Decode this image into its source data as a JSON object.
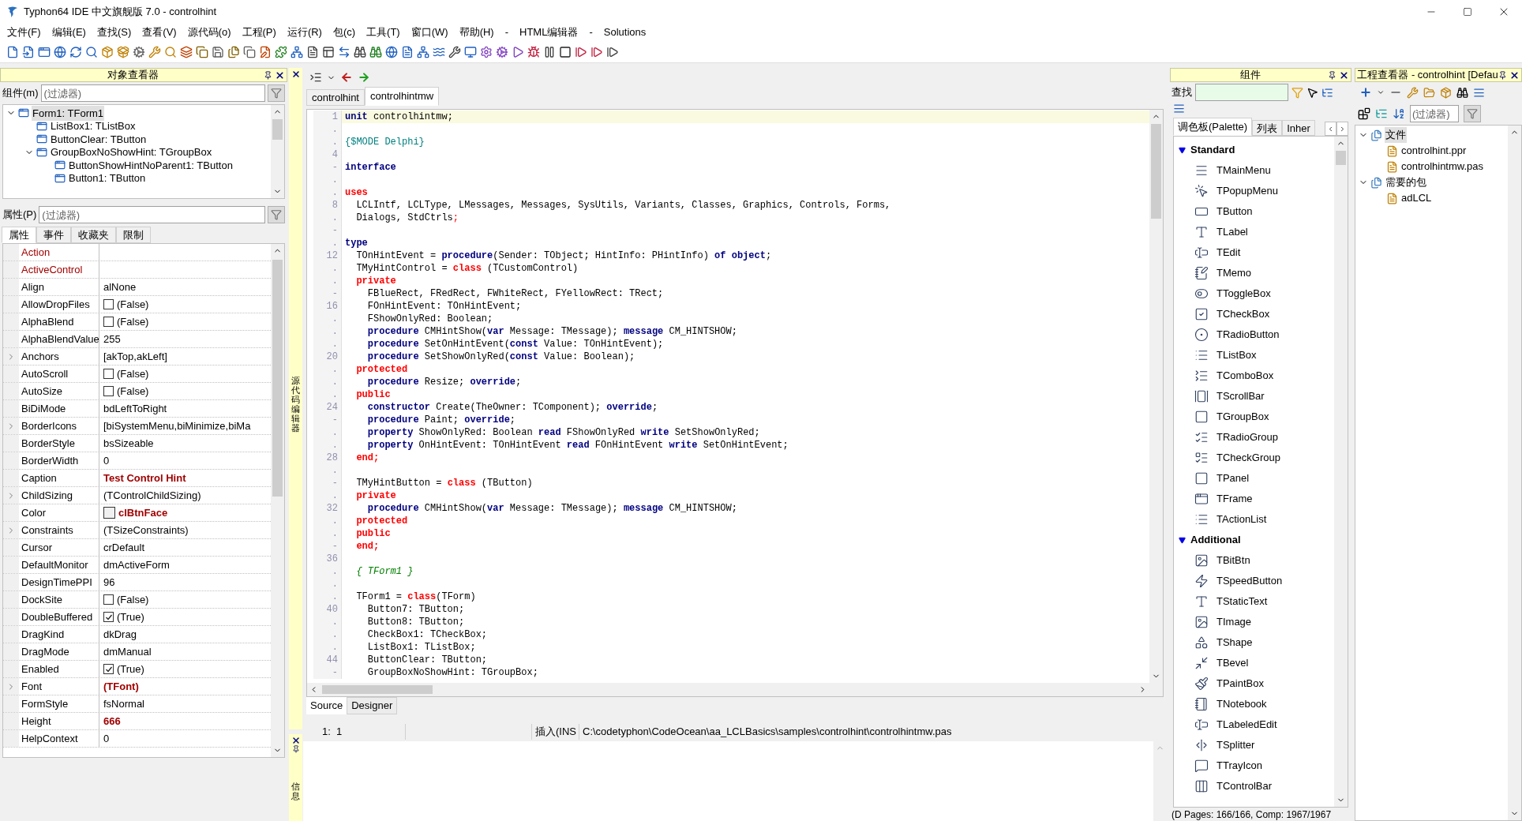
{
  "window": {
    "title": "Typhon64 IDE 中文旗舰版 7.0 - controlhint"
  },
  "menu": [
    "文件(F)",
    "编辑(E)",
    "查找(S)",
    "查看(V)",
    "源代码(o)",
    "工程(P)",
    "运行(R)",
    "包(c)",
    "工具(T)",
    "窗口(W)",
    "帮助(H)",
    "-",
    "HTML编辑器",
    "-",
    "Solutions"
  ],
  "object_inspector": {
    "title": "对象查看器",
    "component_filter": {
      "label": "组件(m)",
      "placeholder": "(过滤器)"
    },
    "tree": [
      {
        "label": "Form1: TForm1",
        "selected": true,
        "expanded": true,
        "children": [
          {
            "label": "ListBox1: TListBox",
            "selected": false
          },
          {
            "label": "ButtonClear: TButton",
            "selected": false
          },
          {
            "label": "GroupBoxNoShowHint: TGroupBox",
            "selected": false,
            "expanded": true,
            "children": [
              {
                "label": "ButtonShowHintNoParent1: TButton",
                "selected": false
              },
              {
                "label": "Button1: TButton",
                "selected": false
              }
            ]
          }
        ]
      }
    ],
    "property_filter": {
      "label": "属性(P)",
      "placeholder": "(过滤器)"
    },
    "tabs": [
      {
        "label": "属性",
        "selected": true
      },
      {
        "label": "事件",
        "selected": false
      },
      {
        "label": "收藏夹",
        "selected": false
      },
      {
        "label": "限制",
        "selected": false
      }
    ],
    "properties": [
      {
        "name": "Action",
        "kind": "text",
        "link": true,
        "expandable": false
      },
      {
        "name": "ActiveControl",
        "kind": "text",
        "link": true,
        "expandable": false
      },
      {
        "name": "Align",
        "value": "alNone",
        "kind": "text",
        "link": false,
        "expandable": false,
        "modified": false
      },
      {
        "name": "AllowDropFiles",
        "value": "(False)",
        "kind": "bool",
        "checked": false,
        "link": false,
        "expandable": false,
        "modified": false
      },
      {
        "name": "AlphaBlend",
        "value": "(False)",
        "kind": "bool",
        "checked": false,
        "link": false,
        "expandable": false,
        "modified": false
      },
      {
        "name": "AlphaBlendValue",
        "value": "255",
        "kind": "text",
        "link": false,
        "expandable": false,
        "modified": false
      },
      {
        "name": "Anchors",
        "value": "[akTop,akLeft]",
        "kind": "text",
        "link": false,
        "expandable": true,
        "modified": false
      },
      {
        "name": "AutoScroll",
        "value": "(False)",
        "kind": "bool",
        "checked": false,
        "link": false,
        "expandable": false,
        "modified": false
      },
      {
        "name": "AutoSize",
        "value": "(False)",
        "kind": "bool",
        "checked": false,
        "link": false,
        "expandable": false,
        "modified": false
      },
      {
        "name": "BiDiMode",
        "value": "bdLeftToRight",
        "kind": "text",
        "link": false,
        "expandable": false,
        "modified": false
      },
      {
        "name": "BorderIcons",
        "value": "[biSystemMenu,biMinimize,biMa",
        "kind": "text",
        "link": false,
        "expandable": true,
        "modified": false
      },
      {
        "name": "BorderStyle",
        "value": "bsSizeable",
        "kind": "text",
        "link": false,
        "expandable": false,
        "modified": false
      },
      {
        "name": "BorderWidth",
        "value": "0",
        "kind": "text",
        "link": false,
        "expandable": false,
        "modified": false
      },
      {
        "name": "Caption",
        "value": "Test Control Hint",
        "kind": "text",
        "link": false,
        "expandable": false,
        "modified": true
      },
      {
        "name": "ChildSizing",
        "value": "(TControlChildSizing)",
        "kind": "text",
        "link": false,
        "expandable": true,
        "modified": false
      },
      {
        "name": "Color",
        "value": "clBtnFace",
        "kind": "color",
        "color": "#f0f0f0",
        "link": false,
        "expandable": false,
        "modified": true
      },
      {
        "name": "Constraints",
        "value": "(TSizeConstraints)",
        "kind": "text",
        "link": false,
        "expandable": true,
        "modified": false
      },
      {
        "name": "Cursor",
        "value": "crDefault",
        "kind": "text",
        "link": false,
        "expandable": false,
        "modified": false
      },
      {
        "name": "DefaultMonitor",
        "value": "dmActiveForm",
        "kind": "text",
        "link": false,
        "expandable": false,
        "modified": false
      },
      {
        "name": "DesignTimePPI",
        "value": "96",
        "kind": "text",
        "link": false,
        "expandable": false,
        "modified": false
      },
      {
        "name": "DockSite",
        "value": "(False)",
        "kind": "bool",
        "checked": false,
        "link": false,
        "expandable": false,
        "modified": false
      },
      {
        "name": "DoubleBuffered",
        "value": "(True)",
        "kind": "bool",
        "checked": true,
        "link": false,
        "expandable": false,
        "modified": false
      },
      {
        "name": "DragKind",
        "value": "dkDrag",
        "kind": "text",
        "link": false,
        "expandable": false,
        "modified": false
      },
      {
        "name": "DragMode",
        "value": "dmManual",
        "kind": "text",
        "link": false,
        "expandable": false,
        "modified": false
      },
      {
        "name": "Enabled",
        "value": "(True)",
        "kind": "bool",
        "checked": true,
        "link": false,
        "expandable": false,
        "modified": false
      },
      {
        "name": "Font",
        "value": "(TFont)",
        "kind": "text",
        "link": false,
        "expandable": true,
        "modified": true
      },
      {
        "name": "FormStyle",
        "value": "fsNormal",
        "kind": "text",
        "link": false,
        "expandable": false,
        "modified": false
      },
      {
        "name": "Height",
        "value": "666",
        "kind": "text",
        "link": false,
        "expandable": false,
        "modified": true
      },
      {
        "name": "HelpContext",
        "value": "0",
        "kind": "text",
        "link": false,
        "expandable": false,
        "modified": false
      }
    ]
  },
  "editor": {
    "side_label": "源代码编辑器",
    "tabs": [
      {
        "label": "controlhint",
        "selected": false
      },
      {
        "label": "controlhintmw",
        "selected": true
      }
    ],
    "lines": [
      {
        "gutter": "1",
        "current": true,
        "tokens": [
          {
            "kind": "keyword",
            "text": "unit"
          },
          {
            "kind": "plain",
            "text": " controlhintmw;"
          }
        ]
      },
      {
        "gutter": ".",
        "current": false
      },
      {
        "gutter": ".",
        "current": false,
        "tokens": [
          {
            "kind": "directive",
            "text": "{$MODE Delphi}"
          }
        ]
      },
      {
        "gutter": "4",
        "current": false
      },
      {
        "gutter": "-",
        "current": false,
        "tokens": [
          {
            "kind": "keyword",
            "text": "interface"
          }
        ]
      },
      {
        "gutter": ".",
        "current": false
      },
      {
        "gutter": ".",
        "current": false,
        "tokens": [
          {
            "kind": "reserved",
            "text": "uses"
          }
        ]
      },
      {
        "gutter": "8",
        "current": false,
        "tokens": [
          {
            "kind": "plain",
            "text": "  LCLIntf, LCLType, LMessages, Messages, SysUtils, Variants, Classes, Graphics, Controls, Forms,"
          }
        ]
      },
      {
        "gutter": ".",
        "current": false,
        "tokens": [
          {
            "kind": "plain",
            "text": "  Dialogs, StdCtrls"
          },
          {
            "kind": "symbol",
            "text": ";"
          }
        ]
      },
      {
        "gutter": "-",
        "current": false
      },
      {
        "gutter": ".",
        "current": false,
        "tokens": [
          {
            "kind": "keyword",
            "text": "type"
          }
        ]
      },
      {
        "gutter": "12",
        "current": false,
        "tokens": [
          {
            "kind": "plain",
            "text": "  TOnHintEvent = "
          },
          {
            "kind": "keyword",
            "text": "procedure"
          },
          {
            "kind": "plain",
            "text": "(Sender: TObject; HintInfo: PHintInfo) "
          },
          {
            "kind": "keyword",
            "text": "of object"
          },
          {
            "kind": "plain",
            "text": ";"
          }
        ]
      },
      {
        "gutter": ".",
        "current": false,
        "tokens": [
          {
            "kind": "plain",
            "text": "  TMyHintControl = "
          },
          {
            "kind": "reserved",
            "text": "class"
          },
          {
            "kind": "plain",
            "text": " (TCustomControl)"
          }
        ]
      },
      {
        "gutter": ".",
        "current": false,
        "tokens": [
          {
            "kind": "reserved",
            "text": "  private"
          }
        ]
      },
      {
        "gutter": "-",
        "current": false,
        "tokens": [
          {
            "kind": "plain",
            "text": "    FBlueRect, FRedRect, FWhiteRect, FYellowRect: TRect;"
          }
        ]
      },
      {
        "gutter": "16",
        "current": false,
        "tokens": [
          {
            "kind": "plain",
            "text": "    FOnHintEvent: TOnHintEvent;"
          }
        ]
      },
      {
        "gutter": ".",
        "current": false,
        "tokens": [
          {
            "kind": "plain",
            "text": "    FShowOnlyRed: Boolean;"
          }
        ]
      },
      {
        "gutter": ".",
        "current": false,
        "tokens": [
          {
            "kind": "keyword",
            "text": "    procedure"
          },
          {
            "kind": "plain",
            "text": " CMHintShow("
          },
          {
            "kind": "keyword",
            "text": "var"
          },
          {
            "kind": "plain",
            "text": " Message: TMessage); "
          },
          {
            "kind": "keyword",
            "text": "message"
          },
          {
            "kind": "plain",
            "text": " CM_HINTSHOW;"
          }
        ]
      },
      {
        "gutter": ".",
        "current": false,
        "tokens": [
          {
            "kind": "keyword",
            "text": "    procedure"
          },
          {
            "kind": "plain",
            "text": " SetOnHintEvent("
          },
          {
            "kind": "keyword",
            "text": "const"
          },
          {
            "kind": "plain",
            "text": " Value: TOnHintEvent);"
          }
        ]
      },
      {
        "gutter": "20",
        "current": false,
        "tokens": [
          {
            "kind": "keyword",
            "text": "    procedure"
          },
          {
            "kind": "plain",
            "text": " SetShowOnlyRed("
          },
          {
            "kind": "keyword",
            "text": "const"
          },
          {
            "kind": "plain",
            "text": " Value: Boolean);"
          }
        ]
      },
      {
        "gutter": ".",
        "current": false,
        "tokens": [
          {
            "kind": "reserved",
            "text": "  protected"
          }
        ]
      },
      {
        "gutter": ".",
        "current": false,
        "tokens": [
          {
            "kind": "keyword",
            "text": "    procedure"
          },
          {
            "kind": "plain",
            "text": " Resize; "
          },
          {
            "kind": "keyword",
            "text": "override"
          },
          {
            "kind": "plain",
            "text": ";"
          }
        ]
      },
      {
        "gutter": ".",
        "current": false,
        "tokens": [
          {
            "kind": "reserved",
            "text": "  public"
          }
        ]
      },
      {
        "gutter": "24",
        "current": false,
        "tokens": [
          {
            "kind": "keyword",
            "text": "    constructor"
          },
          {
            "kind": "plain",
            "text": " Create(TheOwner: TComponent); "
          },
          {
            "kind": "keyword",
            "text": "override"
          },
          {
            "kind": "plain",
            "text": ";"
          }
        ]
      },
      {
        "gutter": "-",
        "current": false,
        "tokens": [
          {
            "kind": "keyword",
            "text": "    procedure"
          },
          {
            "kind": "plain",
            "text": " Paint; "
          },
          {
            "kind": "keyword",
            "text": "override"
          },
          {
            "kind": "plain",
            "text": ";"
          }
        ]
      },
      {
        "gutter": ".",
        "current": false,
        "tokens": [
          {
            "kind": "keyword",
            "text": "    property"
          },
          {
            "kind": "plain",
            "text": " ShowOnlyRed: Boolean "
          },
          {
            "kind": "keyword",
            "text": "read"
          },
          {
            "kind": "plain",
            "text": " FShowOnlyRed "
          },
          {
            "kind": "keyword",
            "text": "write"
          },
          {
            "kind": "plain",
            "text": " SetShowOnlyRed;"
          }
        ]
      },
      {
        "gutter": ".",
        "current": false,
        "tokens": [
          {
            "kind": "keyword",
            "text": "    property"
          },
          {
            "kind": "plain",
            "text": " OnHintEvent: TOnHintEvent "
          },
          {
            "kind": "keyword",
            "text": "read"
          },
          {
            "kind": "plain",
            "text": " FOnHintEvent "
          },
          {
            "kind": "keyword",
            "text": "write"
          },
          {
            "kind": "plain",
            "text": " SetOnHintEvent;"
          }
        ]
      },
      {
        "gutter": "28",
        "current": false,
        "tokens": [
          {
            "kind": "reserved",
            "text": "  end;"
          }
        ]
      },
      {
        "gutter": ".",
        "current": false
      },
      {
        "gutter": "-",
        "current": false,
        "tokens": [
          {
            "kind": "plain",
            "text": "  TMyHintButton = "
          },
          {
            "kind": "reserved",
            "text": "class"
          },
          {
            "kind": "plain",
            "text": " (TButton)"
          }
        ]
      },
      {
        "gutter": ".",
        "current": false,
        "tokens": [
          {
            "kind": "reserved",
            "text": "  private"
          }
        ]
      },
      {
        "gutter": "32",
        "current": false,
        "tokens": [
          {
            "kind": "keyword",
            "text": "    procedure"
          },
          {
            "kind": "plain",
            "text": " CMHintShow("
          },
          {
            "kind": "keyword",
            "text": "var"
          },
          {
            "kind": "plain",
            "text": " Message: TMessage); "
          },
          {
            "kind": "keyword",
            "text": "message"
          },
          {
            "kind": "plain",
            "text": " CM_HINTSHOW;"
          }
        ]
      },
      {
        "gutter": ".",
        "current": false,
        "tokens": [
          {
            "kind": "reserved",
            "text": "  protected"
          }
        ]
      },
      {
        "gutter": ".",
        "current": false,
        "tokens": [
          {
            "kind": "reserved",
            "text": "  public"
          }
        ]
      },
      {
        "gutter": "-",
        "current": false,
        "tokens": [
          {
            "kind": "reserved",
            "text": "  end;"
          }
        ]
      },
      {
        "gutter": "36",
        "current": false
      },
      {
        "gutter": ".",
        "current": false,
        "tokens": [
          {
            "kind": "comment",
            "text": "  { TForm1 }"
          }
        ]
      },
      {
        "gutter": ".",
        "current": false
      },
      {
        "gutter": ".",
        "current": false,
        "tokens": [
          {
            "kind": "plain",
            "text": "  TForm1 = "
          },
          {
            "kind": "reserved",
            "text": "class"
          },
          {
            "kind": "plain",
            "text": "(TForm)"
          }
        ]
      },
      {
        "gutter": "40",
        "current": false,
        "tokens": [
          {
            "kind": "plain",
            "text": "    Button7: TButton;"
          }
        ]
      },
      {
        "gutter": ".",
        "current": false,
        "tokens": [
          {
            "kind": "plain",
            "text": "    Button8: TButton;"
          }
        ]
      },
      {
        "gutter": ".",
        "current": false,
        "tokens": [
          {
            "kind": "plain",
            "text": "    CheckBox1: TCheckBox;"
          }
        ]
      },
      {
        "gutter": ".",
        "current": false,
        "tokens": [
          {
            "kind": "plain",
            "text": "    ListBox1: TListBox;"
          }
        ]
      },
      {
        "gutter": "44",
        "current": false,
        "tokens": [
          {
            "kind": "plain",
            "text": "    ButtonClear: TButton;"
          }
        ]
      },
      {
        "gutter": "-",
        "current": false,
        "tokens": [
          {
            "kind": "plain",
            "text": "    GroupBoxNoShowHint: TGroupBox;"
          }
        ]
      }
    ],
    "bottom_tabs": [
      {
        "label": "Source",
        "selected": true
      },
      {
        "label": "Designer",
        "selected": false
      }
    ],
    "status_bar": {
      "position": "1:  1",
      "mode": "插入(INS",
      "path": "C:\\codetyphon\\CodeOcean\\aa_LCLBasics\\samples\\controlhint\\controlhintmw.pas"
    }
  },
  "messages": {
    "side_label": "信息"
  },
  "components": {
    "title": "组件",
    "search_label": "查找",
    "tabs": [
      {
        "label": "调色板(Palette)",
        "selected": true
      },
      {
        "label": "列表",
        "selected": false
      },
      {
        "label": "Inher",
        "selected": false
      }
    ],
    "groups": [
      {
        "label": "Standard",
        "expanded": true,
        "items": [
          "TMainMenu",
          "TPopupMenu",
          "TButton",
          "TLabel",
          "TEdit",
          "TMemo",
          "TToggleBox",
          "TCheckBox",
          "TRadioButton",
          "TListBox",
          "TComboBox",
          "TScrollBar",
          "TGroupBox",
          "TRadioGroup",
          "TCheckGroup",
          "TPanel",
          "TFrame",
          "TActionList"
        ]
      },
      {
        "label": "Additional",
        "expanded": true,
        "items": [
          "TBitBtn",
          "TSpeedButton",
          "TStaticText",
          "TImage",
          "TShape",
          "TBevel",
          "TPaintBox",
          "TNotebook",
          "TLabeledEdit",
          "TSplitter",
          "TTrayIcon",
          "TControlBar"
        ]
      }
    ],
    "status": "(D Pages: 166/166, Comp: 1967/1967"
  },
  "project_inspector": {
    "title": "工程查看器 - controlhint [Defau",
    "filter": {
      "placeholder": "(过滤器)"
    },
    "tree": [
      {
        "label": "文件",
        "selected": true,
        "expanded": true,
        "children": [
          {
            "label": "controlhint.ppr",
            "selected": false
          },
          {
            "label": "controlhintmw.pas",
            "selected": false
          }
        ]
      },
      {
        "label": "需要的包",
        "selected": false,
        "expanded": true,
        "children": [
          {
            "label": "adLCL",
            "selected": false
          }
        ]
      }
    ]
  }
}
